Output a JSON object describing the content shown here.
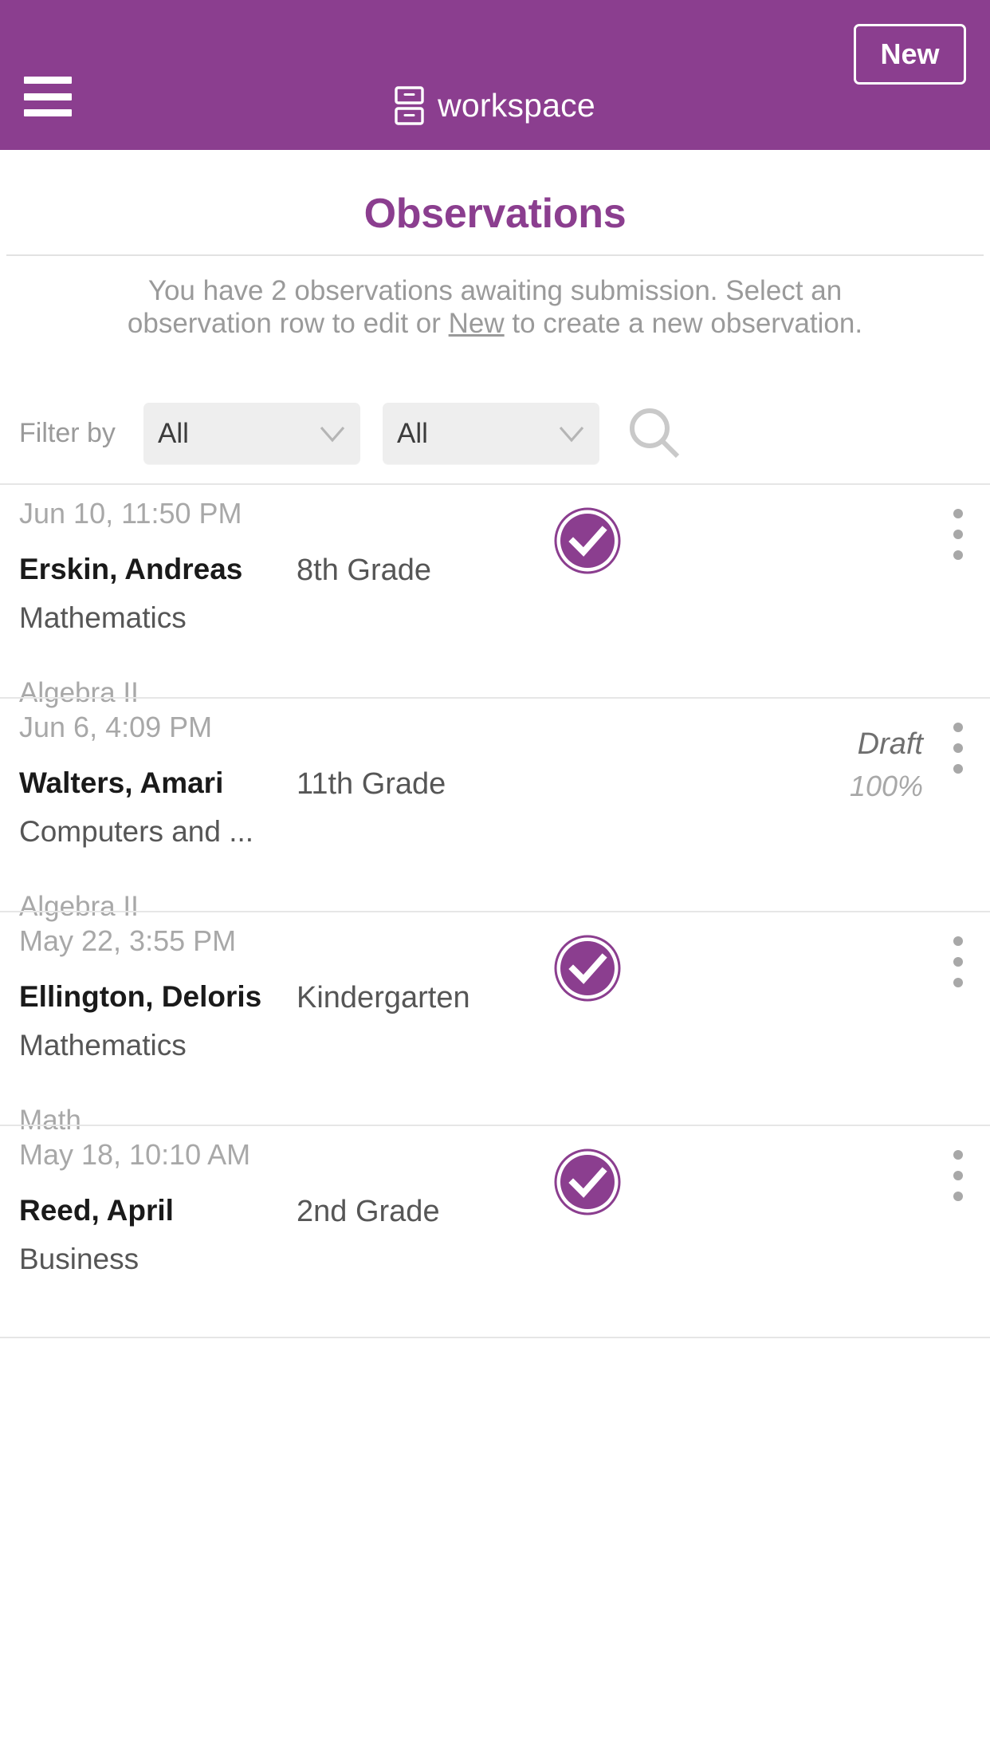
{
  "header": {
    "menu_icon": "hamburger-menu-icon",
    "brand_icon": "file-drawers-icon",
    "brand_name": "workspace",
    "new_button": "New",
    "bar_color": "#8b3e8f"
  },
  "page": {
    "title": "Observations",
    "intro_line1": "You have 2 observations awaiting submission.",
    "intro_line2_pre": "Select an observation row to edit or ",
    "intro_link": "New",
    "intro_line2_post": " to create a new observation."
  },
  "filters": {
    "label": "Filter by",
    "select_one_value": "All",
    "select_two_value": "All",
    "search_icon": "search-icon",
    "chevron_icon": "chevron-down-icon"
  },
  "observations": [
    {
      "date": "Jun 10, 11:50 PM",
      "name": "Erskin, Andreas",
      "subject": "Mathematics",
      "course": "Algebra II",
      "grade": "8th Grade",
      "complete": true,
      "status": "",
      "percent": ""
    },
    {
      "date": "Jun 6, 4:09 PM",
      "name": "Walters, Amari",
      "subject": "Computers and ...",
      "course": "Algebra II",
      "grade": "11th Grade",
      "complete": false,
      "status": "Draft",
      "percent": "100%"
    },
    {
      "date": "May 22, 3:55 PM",
      "name": "Ellington, Deloris",
      "subject": "Mathematics",
      "course": "Math",
      "grade": "Kindergarten",
      "complete": true,
      "status": "",
      "percent": ""
    },
    {
      "date": "May 18, 10:10 AM",
      "name": "Reed, April",
      "subject": "Business",
      "course": "",
      "grade": "2nd Grade",
      "complete": true,
      "status": "",
      "percent": ""
    }
  ],
  "colors": {
    "brand_purple": "#8b3e8f",
    "muted_text": "#9a9a9a",
    "divider": "#e6e6e6"
  }
}
